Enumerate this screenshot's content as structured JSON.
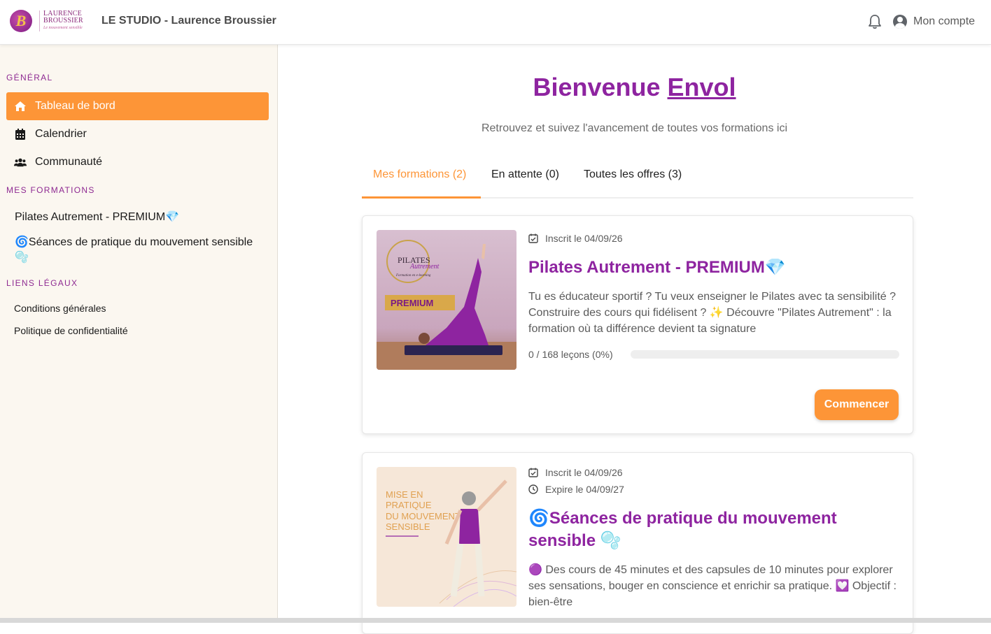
{
  "header": {
    "logo_line1": "LAURENCE",
    "logo_line2": "BROUSSIER",
    "logo_line3": "Le mouvement sensible",
    "app_title": "LE STUDIO - Laurence Broussier",
    "account_label": "Mon compte"
  },
  "sidebar": {
    "general_title": "GÉNÉRAL",
    "nav": [
      {
        "label": "Tableau de bord",
        "icon": "home-icon",
        "active": true
      },
      {
        "label": "Calendrier",
        "icon": "calendar-icon",
        "active": false
      },
      {
        "label": "Communauté",
        "icon": "users-icon",
        "active": false
      }
    ],
    "formations_title": "MES FORMATIONS",
    "formations": [
      {
        "label": "Pilates Autrement - PREMIUM💎"
      },
      {
        "label": "🌀Séances de pratique du mouvement sensible 🫧"
      }
    ],
    "legal_title": "LIENS LÉGAUX",
    "legal": [
      {
        "label": "Conditions générales"
      },
      {
        "label": "Politique de confidentialité"
      }
    ]
  },
  "main": {
    "welcome_prefix": "Bienvenue ",
    "user_name": "Envol",
    "subtitle": "Retrouvez et suivez l'avancement de toutes vos formations ici",
    "tabs": [
      {
        "label": "Mes formations (2)",
        "active": true
      },
      {
        "label": "En attente (0)",
        "active": false
      },
      {
        "label": "Toutes les offres (3)",
        "active": false
      }
    ],
    "cards": [
      {
        "thumb_brand": "PILATES",
        "thumb_brand2": "Autrement",
        "thumb_tagline": "Formation en e-learning",
        "thumb_badge": "PREMIUM",
        "enrolled": "Inscrit le 04/09/26",
        "title": "Pilates Autrement - PREMIUM💎",
        "description": "Tu es éducateur sportif ? Tu veux enseigner le Pilates avec ta sensibilité ? Construire des cours qui fidélisent ? ✨ Découvre \"Pilates Autrement\" : la formation où ta différence devient ta signature",
        "progress_label": "0 / 168 leçons (0%)",
        "progress_percent": 0,
        "button_label": "Commencer"
      },
      {
        "thumb_text": "MISE EN PRATIQUE DU MOUVEMENT SENSIBLE",
        "enrolled": "Inscrit le 04/09/26",
        "expires": "Expire le 04/09/27",
        "title": "🌀Séances de pratique du mouvement sensible 🫧",
        "description": "🟣 Des cours de 45 minutes et des capsules de 10 minutes pour explorer ses sensations, bouger en conscience et enrichir sa pratique. 💟 Objectif : bien-être"
      }
    ]
  },
  "colors": {
    "accent": "#fd9537",
    "brand_purple": "#8e24a0",
    "sidebar_bg": "#fbf7f0"
  }
}
